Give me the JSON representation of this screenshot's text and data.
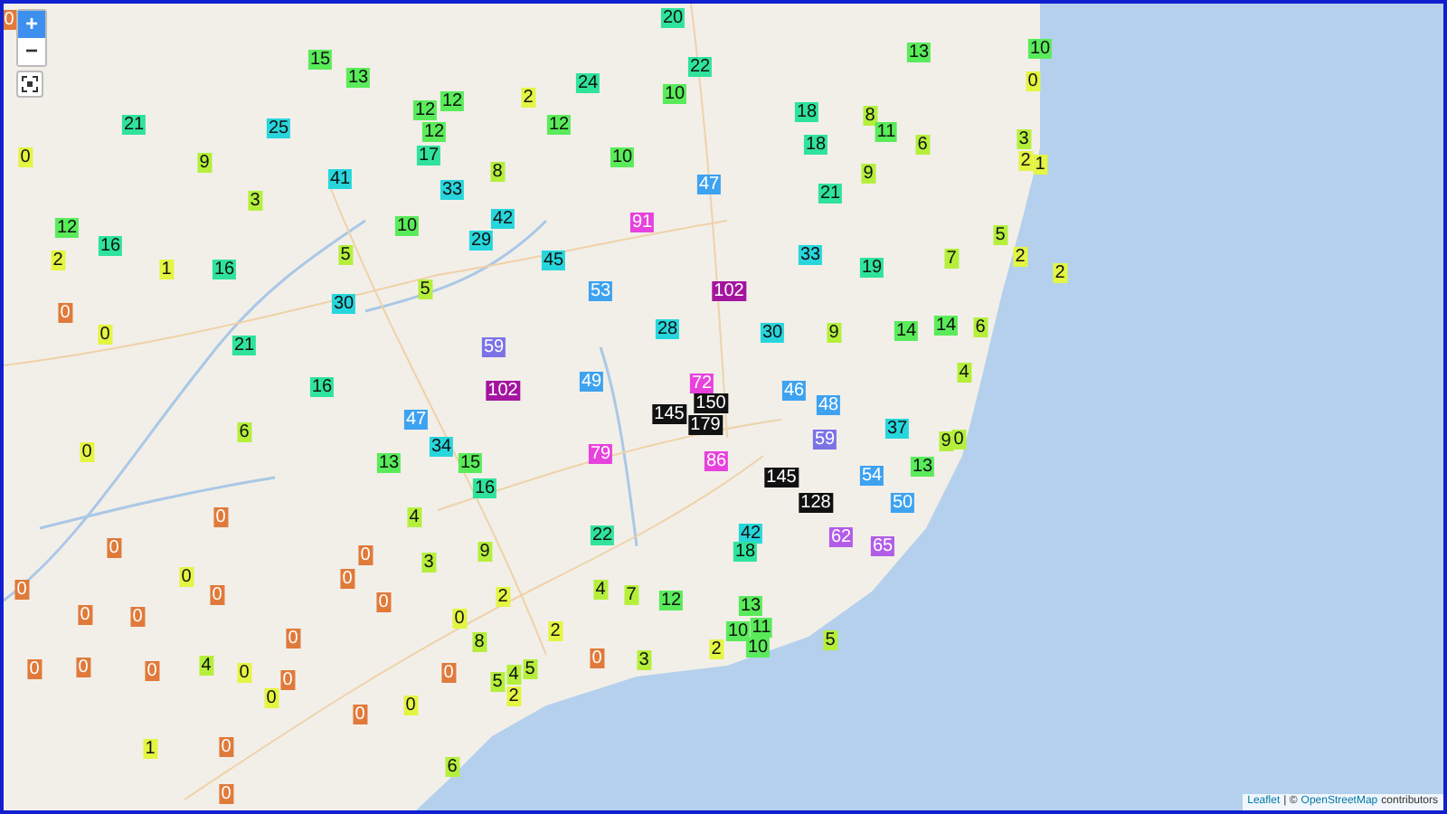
{
  "map": {
    "markers": [
      {
        "value": "0",
        "color": "#e07a3a"
      },
      {
        "value": "15",
        "color": "#5aeb5a"
      },
      {
        "value": "13",
        "color": "#5aeb5a"
      },
      {
        "value": "12",
        "color": "#5aeb5a"
      },
      {
        "value": "12",
        "color": "#5aeb5a"
      },
      {
        "value": "12",
        "color": "#5aeb5a"
      },
      {
        "value": "17",
        "color": "#2fe39a"
      },
      {
        "value": "21",
        "color": "#2fe39a"
      },
      {
        "value": "25",
        "color": "#27d6dc"
      },
      {
        "value": "0",
        "color": "#e4f542"
      },
      {
        "value": "9",
        "color": "#b5ef3c"
      },
      {
        "value": "41",
        "color": "#27d6dc"
      },
      {
        "value": "3",
        "color": "#b5ef3c"
      },
      {
        "value": "33",
        "color": "#27d6dc"
      },
      {
        "value": "12",
        "color": "#5aeb5a"
      },
      {
        "value": "16",
        "color": "#2fe39a"
      },
      {
        "value": "10",
        "color": "#5aeb5a"
      },
      {
        "value": "29",
        "color": "#27d6dc"
      },
      {
        "value": "2",
        "color": "#e4f542"
      },
      {
        "value": "1",
        "color": "#e4f542"
      },
      {
        "value": "16",
        "color": "#2fe39a"
      },
      {
        "value": "5",
        "color": "#b5ef3c"
      },
      {
        "value": "5",
        "color": "#b5ef3c"
      },
      {
        "value": "0",
        "color": "#e07a3a"
      },
      {
        "value": "30",
        "color": "#27d6dc"
      },
      {
        "value": "0",
        "color": "#e4f542"
      },
      {
        "value": "21",
        "color": "#2fe39a"
      },
      {
        "value": "16",
        "color": "#2fe39a"
      },
      {
        "value": "20",
        "color": "#2fe39a"
      },
      {
        "value": "13",
        "color": "#5aeb5a"
      },
      {
        "value": "22",
        "color": "#2fe39a"
      },
      {
        "value": "24",
        "color": "#2fe39a"
      },
      {
        "value": "2",
        "color": "#e4f542"
      },
      {
        "value": "10",
        "color": "#5aeb5a"
      },
      {
        "value": "12",
        "color": "#5aeb5a"
      },
      {
        "value": "18",
        "color": "#2fe39a"
      },
      {
        "value": "8",
        "color": "#b5ef3c"
      },
      {
        "value": "11",
        "color": "#5aeb5a"
      },
      {
        "value": "18",
        "color": "#2fe39a"
      },
      {
        "value": "6",
        "color": "#b5ef3c"
      },
      {
        "value": "10",
        "color": "#5aeb5a"
      },
      {
        "value": "8",
        "color": "#b5ef3c"
      },
      {
        "value": "9",
        "color": "#b5ef3c"
      },
      {
        "value": "47",
        "color": "#3da2f0"
      },
      {
        "value": "21",
        "color": "#2fe39a"
      },
      {
        "value": "42",
        "color": "#27d6dc"
      },
      {
        "value": "91",
        "color": "#e742dd"
      },
      {
        "value": "45",
        "color": "#27d6dc"
      },
      {
        "value": "33",
        "color": "#27d6dc"
      },
      {
        "value": "19",
        "color": "#2fe39a"
      },
      {
        "value": "7",
        "color": "#b5ef3c"
      },
      {
        "value": "53",
        "color": "#3da2f0"
      },
      {
        "value": "102",
        "color": "#a3159e"
      },
      {
        "value": "28",
        "color": "#27d6dc"
      },
      {
        "value": "30",
        "color": "#27d6dc"
      },
      {
        "value": "9",
        "color": "#b5ef3c"
      },
      {
        "value": "14",
        "color": "#5aeb5a"
      },
      {
        "value": "14",
        "color": "#5aeb5a"
      },
      {
        "value": "4",
        "color": "#b5ef3c"
      },
      {
        "value": "59",
        "color": "#7b72e6"
      },
      {
        "value": "102",
        "color": "#a3159e"
      },
      {
        "value": "49",
        "color": "#3da2f0"
      },
      {
        "value": "72",
        "color": "#e742dd"
      },
      {
        "value": "46",
        "color": "#3da2f0"
      },
      {
        "value": "48",
        "color": "#3da2f0"
      },
      {
        "value": "10",
        "color": "#5aeb5a"
      },
      {
        "value": "0",
        "color": "#e4f542"
      },
      {
        "value": "3",
        "color": "#b5ef3c"
      },
      {
        "value": "2",
        "color": "#e4f542"
      },
      {
        "value": "1",
        "color": "#e4f542"
      },
      {
        "value": "5",
        "color": "#b5ef3c"
      },
      {
        "value": "2",
        "color": "#e4f542"
      },
      {
        "value": "2",
        "color": "#e4f542"
      },
      {
        "value": "6",
        "color": "#b5ef3c"
      },
      {
        "value": "0",
        "color": "#e4f542"
      },
      {
        "value": "6",
        "color": "#b5ef3c"
      },
      {
        "value": "47",
        "color": "#3da2f0"
      },
      {
        "value": "34",
        "color": "#27d6dc"
      },
      {
        "value": "13",
        "color": "#5aeb5a"
      },
      {
        "value": "15",
        "color": "#5aeb5a"
      },
      {
        "value": "16",
        "color": "#2fe39a"
      },
      {
        "value": "0",
        "color": "#e07a3a"
      },
      {
        "value": "4",
        "color": "#b5ef3c"
      },
      {
        "value": "0",
        "color": "#e07a3a"
      },
      {
        "value": "0",
        "color": "#e07a3a"
      },
      {
        "value": "9",
        "color": "#b5ef3c"
      },
      {
        "value": "3",
        "color": "#b5ef3c"
      },
      {
        "value": "0",
        "color": "#e4f542"
      },
      {
        "value": "0",
        "color": "#e07a3a"
      },
      {
        "value": "0",
        "color": "#e07a3a"
      },
      {
        "value": "0",
        "color": "#e07a3a"
      },
      {
        "value": "0",
        "color": "#e07a3a"
      },
      {
        "value": "0",
        "color": "#e07a3a"
      },
      {
        "value": "0",
        "color": "#e07a3a"
      },
      {
        "value": "0",
        "color": "#e4f542"
      },
      {
        "value": "0",
        "color": "#e07a3a"
      },
      {
        "value": "8",
        "color": "#b5ef3c"
      },
      {
        "value": "0",
        "color": "#e07a3a"
      },
      {
        "value": "0",
        "color": "#e07a3a"
      },
      {
        "value": "0",
        "color": "#e07a3a"
      },
      {
        "value": "4",
        "color": "#b5ef3c"
      },
      {
        "value": "0",
        "color": "#e4f542"
      },
      {
        "value": "0",
        "color": "#e07a3a"
      },
      {
        "value": "0",
        "color": "#e07a3a"
      },
      {
        "value": "0",
        "color": "#e4f542"
      },
      {
        "value": "0",
        "color": "#e07a3a"
      },
      {
        "value": "0",
        "color": "#e4f542"
      },
      {
        "value": "1",
        "color": "#e4f542"
      },
      {
        "value": "0",
        "color": "#e07a3a"
      },
      {
        "value": "6",
        "color": "#b5ef3c"
      },
      {
        "value": "0",
        "color": "#e07a3a"
      },
      {
        "value": "145",
        "color": "#111111"
      },
      {
        "value": "150",
        "color": "#111111"
      },
      {
        "value": "179",
        "color": "#111111"
      },
      {
        "value": "59",
        "color": "#7b72e6"
      },
      {
        "value": "37",
        "color": "#27d6dc"
      },
      {
        "value": "9",
        "color": "#b5ef3c"
      },
      {
        "value": "0",
        "color": "#b5ef3c"
      },
      {
        "value": "79",
        "color": "#e742dd"
      },
      {
        "value": "86",
        "color": "#e742dd"
      },
      {
        "value": "145",
        "color": "#111111"
      },
      {
        "value": "13",
        "color": "#5aeb5a"
      },
      {
        "value": "54",
        "color": "#3da2f0"
      },
      {
        "value": "128",
        "color": "#111111"
      },
      {
        "value": "50",
        "color": "#3da2f0"
      },
      {
        "value": "42",
        "color": "#27d6dc"
      },
      {
        "value": "18",
        "color": "#2fe39a"
      },
      {
        "value": "62",
        "color": "#b25ce8"
      },
      {
        "value": "65",
        "color": "#b25ce8"
      },
      {
        "value": "22",
        "color": "#2fe39a"
      },
      {
        "value": "4",
        "color": "#b5ef3c"
      },
      {
        "value": "7",
        "color": "#b5ef3c"
      },
      {
        "value": "12",
        "color": "#5aeb5a"
      },
      {
        "value": "13",
        "color": "#5aeb5a"
      },
      {
        "value": "2",
        "color": "#e4f542"
      },
      {
        "value": "2",
        "color": "#e4f542"
      },
      {
        "value": "10",
        "color": "#5aeb5a"
      },
      {
        "value": "11",
        "color": "#5aeb5a"
      },
      {
        "value": "2",
        "color": "#e4f542"
      },
      {
        "value": "10",
        "color": "#5aeb5a"
      },
      {
        "value": "5",
        "color": "#b5ef3c"
      },
      {
        "value": "0",
        "color": "#e07a3a"
      },
      {
        "value": "3",
        "color": "#b5ef3c"
      },
      {
        "value": "5",
        "color": "#b5ef3c"
      },
      {
        "value": "4",
        "color": "#b5ef3c"
      },
      {
        "value": "5",
        "color": "#b5ef3c"
      },
      {
        "value": "2",
        "color": "#e4f542"
      }
    ]
  },
  "zoom_controls": {
    "zoom_in": "+",
    "zoom_out": "−"
  },
  "attribution": {
    "library_link": "Leaflet",
    "separator": "|  ©",
    "osm_link": "OpenStreetMap",
    "suffix": "contributors"
  }
}
